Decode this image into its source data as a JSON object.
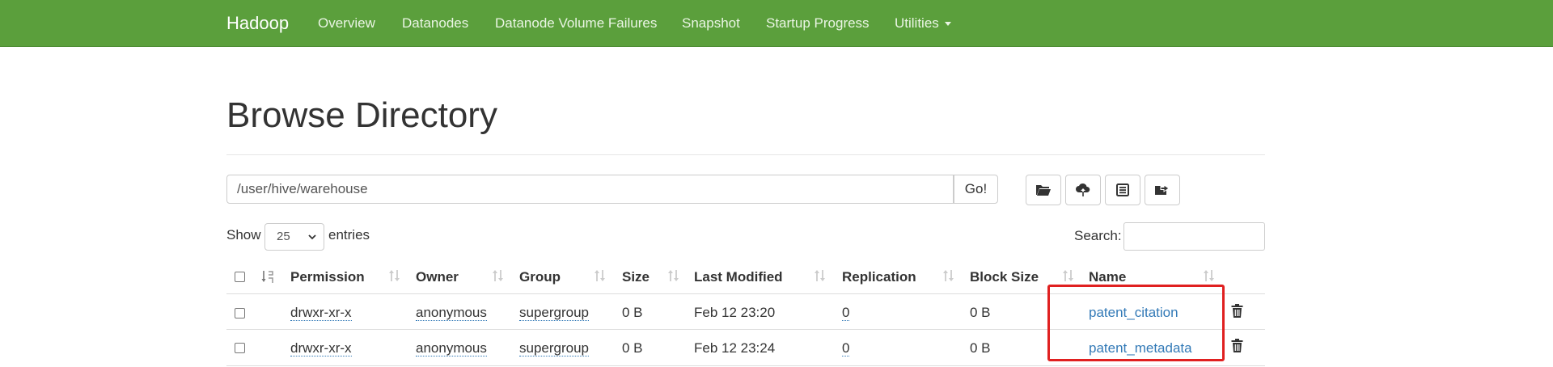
{
  "navbar": {
    "brand": "Hadoop",
    "items": [
      "Overview",
      "Datanodes",
      "Datanode Volume Failures",
      "Snapshot",
      "Startup Progress",
      "Utilities"
    ]
  },
  "page": {
    "title": "Browse Directory"
  },
  "path_bar": {
    "value": "/user/hive/warehouse",
    "go_label": "Go!"
  },
  "toolbar": {
    "icons": [
      "folder-open-icon",
      "upload-icon",
      "list-icon",
      "folder-move-icon"
    ]
  },
  "table_controls": {
    "show_label": "Show",
    "page_size": "25",
    "entries_label": "entries",
    "search_label": "Search:",
    "search_value": ""
  },
  "table": {
    "columns": [
      "Permission",
      "Owner",
      "Group",
      "Size",
      "Last Modified",
      "Replication",
      "Block Size",
      "Name"
    ],
    "rows": [
      {
        "permission": "drwxr-xr-x",
        "owner": "anonymous",
        "group": "supergroup",
        "size": "0 B",
        "last_modified": "Feb 12 23:20",
        "replication": "0",
        "block_size": "0 B",
        "name": "patent_citation"
      },
      {
        "permission": "drwxr-xr-x",
        "owner": "anonymous",
        "group": "supergroup",
        "size": "0 B",
        "last_modified": "Feb 12 23:24",
        "replication": "0",
        "block_size": "0 B",
        "name": "patent_metadata"
      }
    ]
  },
  "colors": {
    "navbar": "#5b9f3c",
    "link": "#337ab7",
    "highlight": "#e02020"
  }
}
